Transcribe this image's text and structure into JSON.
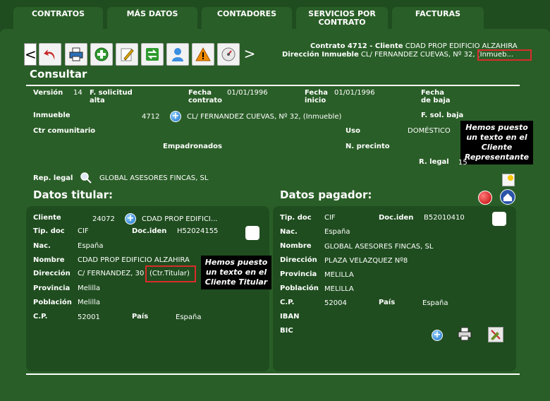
{
  "tabs": [
    {
      "label": "CONTRATOS"
    },
    {
      "label": "MÁS DATOS"
    },
    {
      "label": "CONTADORES"
    },
    {
      "label": "SERVICIOS POR\nCONTRATO"
    },
    {
      "label": "FACTURAS"
    }
  ],
  "header": {
    "contract_line_bold": "Contrato 4712 - Cliente",
    "contract_line_value": "CDAD PROP EDIFICIO ALZAHIRA",
    "address_line_bold": "Dirección Inmueble",
    "address_line_value": "CL/ FERNANDEZ CUEVAS, Nº 32, (Inmueb..."
  },
  "toolbar": {
    "prev": "<",
    "next": ">"
  },
  "page_title": "Consultar",
  "fields": {
    "version_label": "Versión",
    "version_value": "14",
    "f_solicitud_label": "F. solicitud alta",
    "fecha_contrato_label": "Fecha contrato",
    "fecha_contrato_value": "01/01/1996",
    "fecha_inicio_label": "Fecha inicio",
    "fecha_inicio_value": "01/01/1996",
    "fecha_baja_label": "Fecha de baja",
    "inmueble_label": "Inmueble",
    "inmueble_id": "4712",
    "inmueble_value": "CL/ FERNANDEZ CUEVAS, Nº 32, (Inmueble)",
    "f_sol_baja_label": "F. sol. baja",
    "ctr_comunitario_label": "Ctr comunitario",
    "uso_label": "Uso",
    "uso_value": "DOMÉSTICO",
    "empadronados_label": "Empadronados",
    "n_precinto_label": "N. precinto",
    "r_legal_label": "R. legal",
    "r_legal_value": "15",
    "rep_legal_label": "Rep. legal",
    "rep_legal_value": "GLOBAL ASESORES FINCAS, SL"
  },
  "note_representante": "Hemos puesto un texto en el Cliente Representante",
  "titular": {
    "title": "Datos titular:",
    "cliente_label": "Cliente",
    "cliente_id": "24072",
    "cliente_value": "CDAD PROP EDIFICI...",
    "tipdoc_label": "Tip. doc",
    "tipdoc_value": "CIF",
    "dociden_label": "Doc.iden",
    "dociden_value": "H52024155",
    "nac_label": "Nac.",
    "nac_value": "España",
    "nombre_label": "Nombre",
    "nombre_value": "CDAD PROP EDIFICIO ALZAHIRA",
    "direccion_label": "Dirección",
    "direccion_value": "C/ FERNANDEZ, 30",
    "direccion_tag": "(Ctr.Titular)",
    "provincia_label": "Provincia",
    "provincia_value": "Melilla",
    "poblacion_label": "Población",
    "poblacion_value": "Melilla",
    "cp_label": "C.P.",
    "cp_value": "52001",
    "pais_label": "País",
    "pais_value": "España"
  },
  "note_titular": "Hemos puesto un texto en el Cliente Titular",
  "pagador": {
    "title": "Datos pagador:",
    "tipdoc_label": "Tip. doc",
    "tipdoc_value": "CIF",
    "dociden_label": "Doc.iden",
    "dociden_value": "B52010410",
    "nac_label": "Nac.",
    "nac_value": "España",
    "nombre_label": "Nombre",
    "nombre_value": "GLOBAL ASESORES FINCAS, SL",
    "direccion_label": "Dirección",
    "direccion_value": "PLAZA VELAZQUEZ Nº8",
    "provincia_label": "Provincia",
    "provincia_value": "MELILLA",
    "poblacion_label": "Población",
    "poblacion_value": "MELILLA",
    "cp_label": "C.P.",
    "cp_value": "52004",
    "pais_label": "País",
    "pais_value": "España",
    "iban_label": "IBAN",
    "bic_label": "BIC"
  },
  "colors": {
    "background": "#1f4d1f",
    "panel": "#2a5e28",
    "highlight_red": "#d92c2c",
    "note_bg": "#000000"
  }
}
